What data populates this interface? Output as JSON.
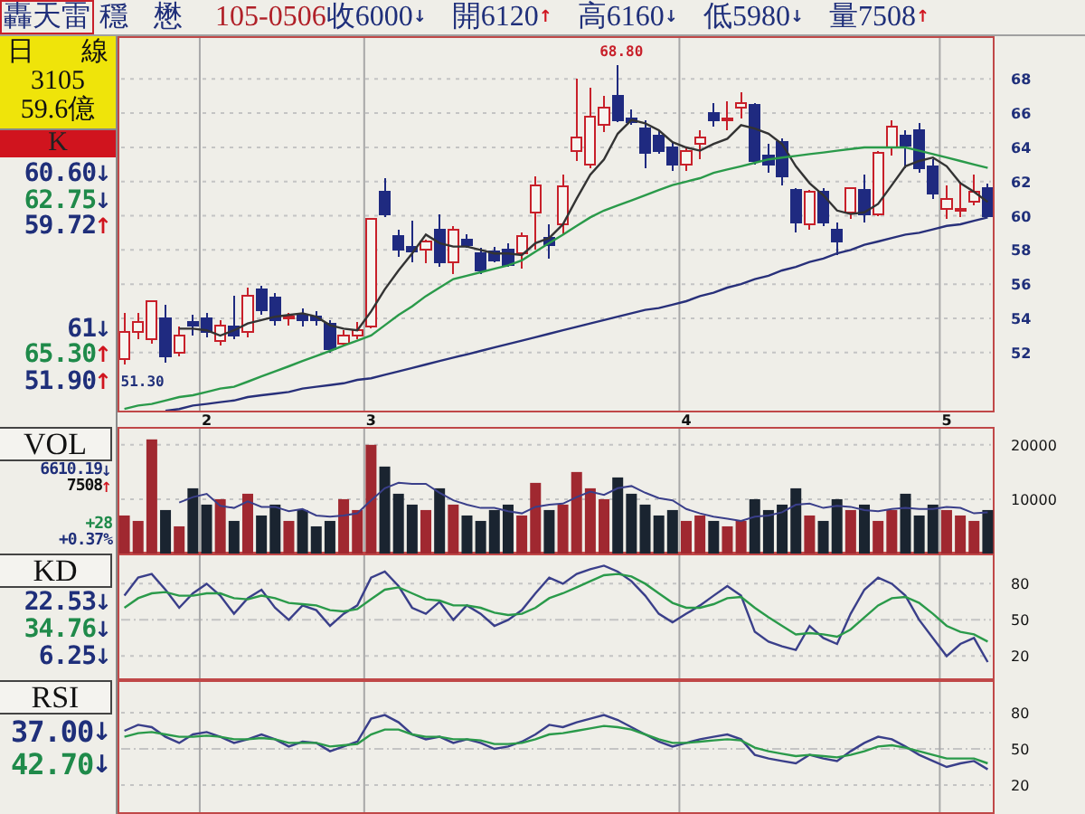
{
  "top_bar": {
    "name": "轟天雷",
    "tags": [
      "穩",
      "懋"
    ],
    "date": "105-0506",
    "quotes": [
      {
        "text": "收6000",
        "arrow": {
          "glyph": "↓",
          "color": "#1f2f7a"
        }
      },
      {
        "text": "開6120",
        "arrow": {
          "glyph": "↑",
          "color": "#d0141e"
        }
      },
      {
        "text": "高6160",
        "arrow": {
          "glyph": "↓",
          "color": "#1f2f7a"
        }
      },
      {
        "text": "低5980",
        "arrow": {
          "glyph": "↓",
          "color": "#1f2f7a"
        }
      },
      {
        "text": "量7508",
        "arrow": {
          "glyph": "↑",
          "color": "#d0141e"
        }
      }
    ]
  },
  "price_side": {
    "period_chars": [
      "日",
      "線"
    ],
    "code": "3105",
    "amount": "59.6億",
    "indicator": "K",
    "reading_groups": [
      [
        {
          "value": "60.60",
          "color": "#1f2f7a",
          "arrow": {
            "glyph": "↓",
            "color": "#1f2f7a"
          }
        },
        {
          "value": "62.75",
          "color": "#1f8a4a",
          "arrow": {
            "glyph": "↓",
            "color": "#1f2f7a"
          }
        },
        {
          "value": "59.72",
          "color": "#1f2f7a",
          "arrow": {
            "glyph": "↑",
            "color": "#d0141e"
          }
        }
      ],
      [
        {
          "value": "61",
          "color": "#1f2f7a",
          "arrow": {
            "glyph": "↓",
            "color": "#1f2f7a"
          }
        },
        {
          "value": "65.30",
          "color": "#1f8a4a",
          "arrow": {
            "glyph": "↑",
            "color": "#d0141e"
          }
        },
        {
          "value": "51.90",
          "color": "#1f2f7a",
          "arrow": {
            "glyph": "↑",
            "color": "#d0141e"
          }
        }
      ]
    ]
  },
  "price_chart": {
    "chart_data": {
      "type": "candlestick",
      "ylim": [
        48.5,
        70.5
      ],
      "yticks": [
        52,
        54,
        56,
        58,
        60,
        62,
        64,
        66,
        68
      ],
      "grid": true,
      "categories": [
        null,
        null,
        null,
        null,
        null,
        null,
        "2",
        null,
        null,
        null,
        null,
        null,
        null,
        null,
        null,
        null,
        null,
        null,
        "3",
        null,
        null,
        null,
        null,
        null,
        null,
        null,
        null,
        null,
        null,
        null,
        null,
        null,
        null,
        null,
        null,
        null,
        null,
        null,
        null,
        null,
        null,
        "4",
        null,
        null,
        null,
        null,
        null,
        null,
        null,
        null,
        null,
        null,
        null,
        null,
        null,
        null,
        null,
        null,
        null,
        null,
        "5",
        null,
        null,
        null
      ],
      "ohlc": [
        [
          51.6,
          54.3,
          51.3,
          53.2
        ],
        [
          53.2,
          54.3,
          52.8,
          53.8
        ],
        [
          52.8,
          55.0,
          52.5,
          55.0
        ],
        [
          54.0,
          54.8,
          51.4,
          51.8
        ],
        [
          52.0,
          53.5,
          51.8,
          53.0
        ],
        [
          53.8,
          54.2,
          53.0,
          53.6
        ],
        [
          54.0,
          54.3,
          52.9,
          53.2
        ],
        [
          52.7,
          53.9,
          52.4,
          53.6
        ],
        [
          53.5,
          55.3,
          52.8,
          53.0
        ],
        [
          53.2,
          55.8,
          52.9,
          55.3
        ],
        [
          55.7,
          55.9,
          54.2,
          54.5
        ],
        [
          55.2,
          55.5,
          53.6,
          53.9
        ],
        [
          54.0,
          54.3,
          53.6,
          54.1
        ],
        [
          54.2,
          54.6,
          53.5,
          53.9
        ],
        [
          54.1,
          54.4,
          53.6,
          53.9
        ],
        [
          53.7,
          53.9,
          52.0,
          52.2
        ],
        [
          52.5,
          53.3,
          52.4,
          53.0
        ],
        [
          53.0,
          53.8,
          52.8,
          53.3
        ],
        [
          53.5,
          59.8,
          53.4,
          59.8
        ],
        [
          61.4,
          62.2,
          59.9,
          60.1
        ],
        [
          58.8,
          59.2,
          57.6,
          58.0
        ],
        [
          58.2,
          59.7,
          57.3,
          57.9
        ],
        [
          58.0,
          58.6,
          57.2,
          58.5
        ],
        [
          59.2,
          60.1,
          57.0,
          57.3
        ],
        [
          57.3,
          59.4,
          56.6,
          59.2
        ],
        [
          58.6,
          58.9,
          58.1,
          58.3
        ],
        [
          57.8,
          58.1,
          56.6,
          56.8
        ],
        [
          57.9,
          58.2,
          57.3,
          57.4
        ],
        [
          58.0,
          58.4,
          57.0,
          57.1
        ],
        [
          57.8,
          59.0,
          56.9,
          58.8
        ],
        [
          60.2,
          62.3,
          58.0,
          61.8
        ],
        [
          58.7,
          59.5,
          57.5,
          58.3
        ],
        [
          59.5,
          62.4,
          58.9,
          61.7
        ],
        [
          63.8,
          68.0,
          63.2,
          64.6
        ],
        [
          63.0,
          67.5,
          62.8,
          65.8
        ],
        [
          65.3,
          67.0,
          64.9,
          66.3
        ],
        [
          67.0,
          68.8,
          65.5,
          65.6
        ],
        [
          65.7,
          66.2,
          65.3,
          65.5
        ],
        [
          65.1,
          65.6,
          62.8,
          63.7
        ],
        [
          64.7,
          65.0,
          63.6,
          63.8
        ],
        [
          64.0,
          64.3,
          62.6,
          63.0
        ],
        [
          63.0,
          64.0,
          62.6,
          63.8
        ],
        [
          64.2,
          65.0,
          63.3,
          64.6
        ],
        [
          66.0,
          66.6,
          65.2,
          65.6
        ],
        [
          65.6,
          66.7,
          65.0,
          65.7
        ],
        [
          66.3,
          67.2,
          65.7,
          66.6
        ],
        [
          66.5,
          66.6,
          63.0,
          63.2
        ],
        [
          63.5,
          64.2,
          62.5,
          63.0
        ],
        [
          64.3,
          64.5,
          61.8,
          62.3
        ],
        [
          61.5,
          61.6,
          59.0,
          59.6
        ],
        [
          59.5,
          61.5,
          59.2,
          61.4
        ],
        [
          61.4,
          61.6,
          59.4,
          59.6
        ],
        [
          59.2,
          59.6,
          57.7,
          58.5
        ],
        [
          60.2,
          61.6,
          59.8,
          61.6
        ],
        [
          61.5,
          62.4,
          59.6,
          60.1
        ],
        [
          60.1,
          63.8,
          60.0,
          63.7
        ],
        [
          64.0,
          65.6,
          63.5,
          65.2
        ],
        [
          64.7,
          65.0,
          62.8,
          64.1
        ],
        [
          65.0,
          65.4,
          62.5,
          62.8
        ],
        [
          62.9,
          63.3,
          61.0,
          61.3
        ],
        [
          60.4,
          61.8,
          59.8,
          61.0
        ],
        [
          60.4,
          62.0,
          59.9,
          60.4
        ],
        [
          60.8,
          62.4,
          60.6,
          61.4
        ],
        [
          61.6,
          61.9,
          59.9,
          60.0
        ]
      ],
      "series": [
        {
          "type": "line",
          "color": "#333333",
          "values": [
            null,
            null,
            null,
            null,
            53.4,
            53.4,
            53.3,
            53.0,
            53.3,
            53.7,
            53.9,
            54.1,
            54.2,
            54.3,
            54.1,
            53.6,
            53.4,
            53.3,
            54.4,
            55.7,
            56.8,
            57.8,
            58.9,
            58.4,
            58.2,
            58.2,
            58.0,
            57.8,
            57.8,
            57.7,
            58.4,
            58.7,
            59.5,
            61.0,
            62.4,
            63.3,
            64.8,
            65.6,
            65.4,
            65.0,
            64.3,
            64.0,
            63.8,
            64.2,
            64.5,
            65.3,
            65.1,
            64.8,
            64.2,
            62.9,
            61.9,
            61.2,
            60.3,
            60.1,
            60.2,
            60.7,
            61.8,
            62.9,
            63.2,
            63.4,
            62.9,
            61.9,
            61.4,
            60.8
          ]
        },
        {
          "type": "line",
          "color": "#2a9a4a",
          "values": [
            48.7,
            48.9,
            49.0,
            49.2,
            49.4,
            49.5,
            49.7,
            49.9,
            50.0,
            50.3,
            50.6,
            50.9,
            51.2,
            51.5,
            51.8,
            52.1,
            52.4,
            52.7,
            53.0,
            53.6,
            54.2,
            54.7,
            55.3,
            55.8,
            56.3,
            56.5,
            56.7,
            56.9,
            57.1,
            57.4,
            57.9,
            58.4,
            58.9,
            59.4,
            59.9,
            60.3,
            60.6,
            60.9,
            61.2,
            61.5,
            61.8,
            62.0,
            62.2,
            62.5,
            62.7,
            62.9,
            63.1,
            63.3,
            63.4,
            63.5,
            63.6,
            63.7,
            63.8,
            63.9,
            64.0,
            64.0,
            64.0,
            64.0,
            63.8,
            63.6,
            63.4,
            63.2,
            63.0,
            62.8
          ]
        },
        {
          "type": "line",
          "color": "#28307a",
          "values": [
            null,
            null,
            null,
            48.6,
            48.7,
            48.9,
            49.0,
            49.1,
            49.2,
            49.4,
            49.5,
            49.6,
            49.7,
            49.9,
            50.0,
            50.1,
            50.2,
            50.4,
            50.5,
            50.7,
            50.9,
            51.1,
            51.3,
            51.5,
            51.7,
            51.9,
            52.1,
            52.3,
            52.5,
            52.7,
            52.9,
            53.1,
            53.3,
            53.5,
            53.7,
            53.9,
            54.1,
            54.3,
            54.5,
            54.6,
            54.8,
            55.0,
            55.3,
            55.5,
            55.8,
            56.0,
            56.3,
            56.5,
            56.8,
            57.0,
            57.3,
            57.5,
            57.8,
            58.0,
            58.3,
            58.5,
            58.7,
            58.9,
            59.0,
            59.2,
            59.4,
            59.5,
            59.7,
            59.9
          ]
        }
      ],
      "annotations": [
        {
          "text": "68.80"
        },
        {
          "text": "51.30"
        }
      ]
    }
  },
  "vol_side": {
    "label": "VOL",
    "readings": [
      {
        "value": "6610.19",
        "color": "#1f2f7a",
        "arrow": {
          "glyph": "↓",
          "color": "#1f2f7a"
        }
      },
      {
        "value": "7508",
        "color": "#111111",
        "arrow": {
          "glyph": "↑",
          "color": "#d0141e"
        }
      },
      {
        "value": "+28",
        "color": "#1f8a4a"
      },
      {
        "value": "+0.37%",
        "color": "#1f2f7a"
      }
    ]
  },
  "vol_chart": {
    "chart_data": {
      "type": "bar",
      "ylim": [
        0,
        23300
      ],
      "yticks": [
        10000,
        20000
      ],
      "grid": true,
      "stacked": true,
      "categories": [
        null,
        null,
        null,
        null,
        null,
        null,
        null,
        null,
        null,
        null,
        null,
        null,
        null,
        null,
        null,
        null,
        null,
        null,
        null,
        null,
        null,
        null,
        null,
        null,
        null,
        null,
        null,
        null,
        null,
        null,
        null,
        null,
        null,
        null,
        null,
        null,
        null,
        null,
        null,
        null,
        null,
        null,
        null,
        null,
        null,
        null,
        null,
        null,
        null,
        null,
        null,
        null,
        null,
        null,
        null,
        null,
        null,
        null,
        null,
        null,
        null,
        null,
        null,
        null
      ],
      "series": [
        {
          "type": "bar",
          "color": "#a02830",
          "values": [
            7000,
            6000,
            21000,
            null,
            5000,
            null,
            null,
            10000,
            null,
            11000,
            null,
            null,
            6000,
            null,
            null,
            null,
            10000,
            8000,
            20000,
            null,
            null,
            null,
            8000,
            null,
            9000,
            null,
            null,
            null,
            null,
            7000,
            13000,
            null,
            9000,
            15000,
            12000,
            10000,
            null,
            null,
            null,
            null,
            null,
            6000,
            7000,
            null,
            5000,
            6000,
            null,
            null,
            null,
            null,
            7000,
            null,
            null,
            8000,
            null,
            6000,
            8000,
            null,
            null,
            null,
            8000,
            7000,
            6000,
            null
          ]
        },
        {
          "type": "bar",
          "color": "#1a2430",
          "values": [
            null,
            null,
            null,
            8000,
            null,
            12000,
            9000,
            null,
            6000,
            null,
            7000,
            9000,
            null,
            8000,
            5000,
            6000,
            null,
            null,
            null,
            16000,
            11000,
            9000,
            null,
            12000,
            null,
            7000,
            6000,
            8000,
            9000,
            null,
            null,
            8000,
            null,
            null,
            null,
            null,
            14000,
            11000,
            9000,
            7000,
            8000,
            null,
            null,
            6000,
            null,
            null,
            10000,
            8000,
            9000,
            12000,
            null,
            6000,
            10000,
            null,
            9000,
            null,
            null,
            11000,
            7000,
            9000,
            null,
            null,
            null,
            8000
          ]
        },
        {
          "type": "line",
          "color": "#3a3f8a",
          "values": [
            null,
            null,
            null,
            null,
            9400,
            10400,
            11000,
            8800,
            8400,
            9600,
            8600,
            8600,
            7800,
            8200,
            7000,
            6800,
            7000,
            7400,
            9800,
            12000,
            13000,
            12800,
            12800,
            11200,
            9800,
            9000,
            8400,
            8400,
            7800,
            7400,
            8600,
            9000,
            9200,
            10400,
            11400,
            10800,
            12000,
            12400,
            11200,
            10200,
            9800,
            8200,
            7400,
            6800,
            6400,
            6000,
            6800,
            7000,
            7600,
            9000,
            9200,
            8400,
            8800,
            8600,
            8000,
            7800,
            8200,
            8400,
            8200,
            8200,
            8600,
            8400,
            7400,
            7600
          ]
        }
      ]
    }
  },
  "kd_side": {
    "label": "KD",
    "readings": [
      {
        "value": "22.53",
        "color": "#1f2f7a",
        "arrow": {
          "glyph": "↓",
          "color": "#1f2f7a"
        }
      },
      {
        "value": "34.76",
        "color": "#1f8a4a",
        "arrow": {
          "glyph": "↓",
          "color": "#1f2f7a"
        }
      },
      {
        "value": "6.25",
        "color": "#1f2f7a",
        "arrow": {
          "glyph": "↓",
          "color": "#1f2f7a"
        }
      }
    ]
  },
  "kd_chart": {
    "chart_data": {
      "type": "line",
      "ylim": [
        0,
        105
      ],
      "yticks": [
        20,
        50,
        80
      ],
      "grid": true,
      "categories": [
        null,
        null,
        null,
        null,
        null,
        null,
        null,
        null,
        null,
        null,
        null,
        null,
        null,
        null,
        null,
        null,
        null,
        null,
        null,
        null,
        null,
        null,
        null,
        null,
        null,
        null,
        null,
        null,
        null,
        null,
        null,
        null,
        null,
        null,
        null,
        null,
        null,
        null,
        null,
        null,
        null,
        null,
        null,
        null,
        null,
        null,
        null,
        null,
        null,
        null,
        null,
        null,
        null,
        null,
        null,
        null,
        null,
        null,
        null,
        null,
        null,
        null,
        null,
        null
      ],
      "series": [
        {
          "color": "#3a3f8a",
          "values": [
            70,
            85,
            88,
            75,
            60,
            72,
            80,
            70,
            55,
            68,
            75,
            60,
            50,
            62,
            58,
            45,
            55,
            62,
            85,
            90,
            78,
            60,
            55,
            65,
            50,
            62,
            55,
            45,
            50,
            58,
            72,
            85,
            80,
            88,
            92,
            95,
            90,
            82,
            70,
            55,
            48,
            55,
            62,
            70,
            78,
            70,
            40,
            32,
            28,
            25,
            45,
            35,
            30,
            55,
            75,
            85,
            80,
            70,
            50,
            35,
            20,
            30,
            35,
            15
          ]
        },
        {
          "color": "#2a9a4a",
          "values": [
            60,
            68,
            72,
            73,
            70,
            70,
            72,
            72,
            68,
            67,
            70,
            68,
            64,
            63,
            62,
            58,
            57,
            59,
            67,
            75,
            77,
            72,
            67,
            66,
            62,
            62,
            60,
            56,
            54,
            55,
            60,
            68,
            72,
            77,
            82,
            87,
            88,
            86,
            80,
            72,
            64,
            60,
            60,
            63,
            68,
            69,
            60,
            52,
            45,
            38,
            39,
            38,
            36,
            42,
            52,
            62,
            68,
            69,
            64,
            55,
            45,
            40,
            38,
            32
          ]
        }
      ]
    }
  },
  "rsi_side": {
    "label": "RSI",
    "readings": [
      {
        "value": "37.00",
        "color": "#1f2f7a",
        "arrow": {
          "glyph": "↓",
          "color": "#1f2f7a"
        }
      },
      {
        "value": "42.70",
        "color": "#1f8a4a",
        "arrow": {
          "glyph": "↓",
          "color": "#1f2f7a"
        }
      }
    ]
  },
  "rsi_chart": {
    "chart_data": {
      "type": "line",
      "ylim": [
        -4,
        107
      ],
      "yticks": [
        20,
        50,
        80
      ],
      "grid": true,
      "categories": [
        null,
        null,
        null,
        null,
        null,
        null,
        null,
        null,
        null,
        null,
        null,
        null,
        null,
        null,
        null,
        null,
        null,
        null,
        null,
        null,
        null,
        null,
        null,
        null,
        null,
        null,
        null,
        null,
        null,
        null,
        null,
        null,
        null,
        null,
        null,
        null,
        null,
        null,
        null,
        null,
        null,
        null,
        null,
        null,
        null,
        null,
        null,
        null,
        null,
        null,
        null,
        null,
        null,
        null,
        null,
        null,
        null,
        null,
        null,
        null,
        null,
        null,
        null,
        null
      ],
      "series": [
        {
          "color": "#3a3f8a",
          "values": [
            65,
            70,
            68,
            60,
            55,
            62,
            64,
            60,
            55,
            58,
            62,
            58,
            52,
            56,
            55,
            48,
            52,
            56,
            75,
            78,
            72,
            62,
            58,
            60,
            55,
            58,
            55,
            50,
            52,
            56,
            62,
            70,
            68,
            72,
            75,
            78,
            74,
            68,
            62,
            56,
            52,
            55,
            58,
            60,
            62,
            58,
            45,
            42,
            40,
            38,
            45,
            42,
            40,
            48,
            55,
            60,
            58,
            52,
            45,
            40,
            35,
            38,
            40,
            33
          ]
        },
        {
          "color": "#2a9a4a",
          "values": [
            60,
            63,
            64,
            62,
            60,
            60,
            61,
            60,
            58,
            58,
            59,
            58,
            55,
            55,
            55,
            52,
            53,
            54,
            62,
            66,
            66,
            62,
            60,
            60,
            58,
            58,
            57,
            54,
            54,
            55,
            58,
            62,
            63,
            65,
            67,
            69,
            68,
            66,
            62,
            58,
            55,
            55,
            56,
            57,
            58,
            57,
            51,
            48,
            46,
            44,
            45,
            44,
            43,
            45,
            48,
            52,
            53,
            51,
            48,
            45,
            42,
            42,
            42,
            38
          ]
        }
      ]
    }
  }
}
